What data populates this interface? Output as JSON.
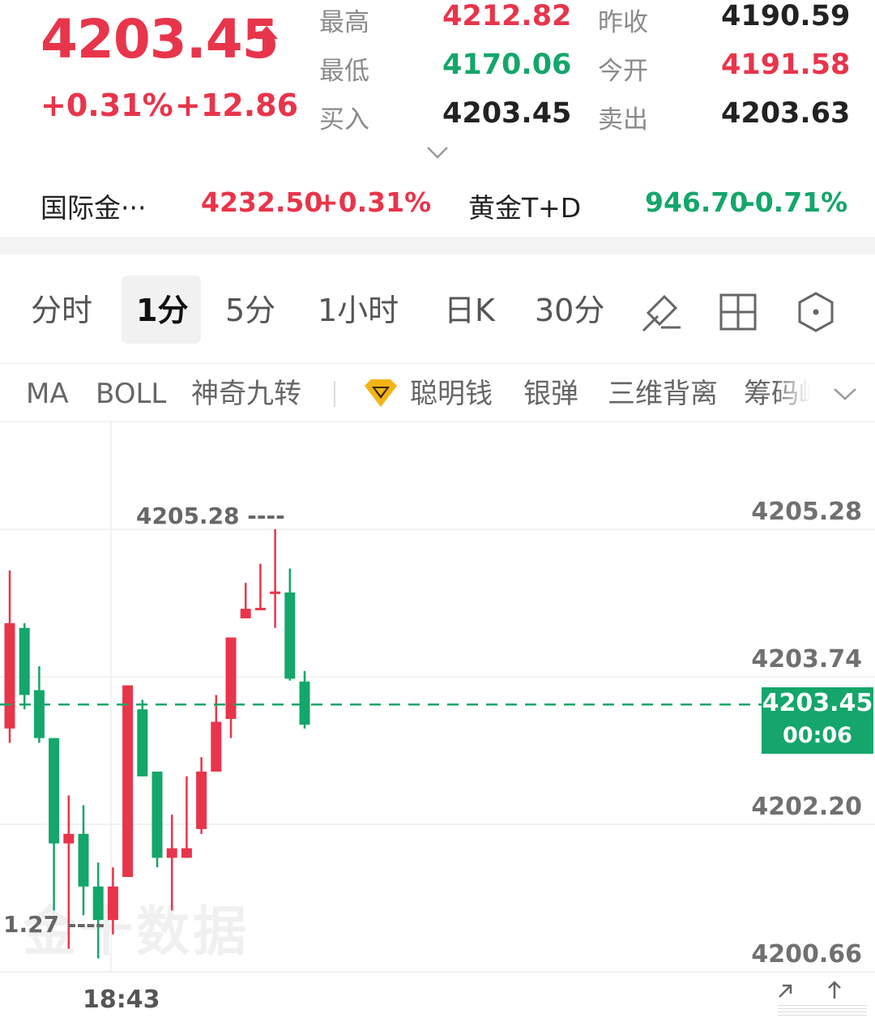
{
  "quote": {
    "price": "4203.45",
    "change_pct": "+0.31%",
    "change_abs": "+12.86",
    "fields": [
      {
        "label": "最高",
        "value": "4212.82",
        "color": "#e8354b"
      },
      {
        "label": "昨收",
        "value": "4190.59",
        "color": "#222222"
      },
      {
        "label": "最低",
        "value": "4170.06",
        "color": "#14a66a"
      },
      {
        "label": "今开",
        "value": "4191.58",
        "color": "#e8354b"
      },
      {
        "label": "买入",
        "value": "4203.45",
        "color": "#222222"
      },
      {
        "label": "卖出",
        "value": "4203.63",
        "color": "#222222"
      }
    ]
  },
  "related": [
    {
      "name": "国际金···",
      "value": "4232.50",
      "pct": "+0.31%",
      "color": "#e8354b"
    },
    {
      "name": "黄金T+D",
      "value": "946.70",
      "pct": "-0.71%",
      "color": "#14a66a"
    }
  ],
  "period_tabs": [
    "分时",
    "1分",
    "5分",
    "1小时",
    "日K",
    "30分"
  ],
  "active_tab": "1分",
  "tool_icons": [
    "draw-tool-icon",
    "grid-layout-icon",
    "hexagon-settings-icon"
  ],
  "indicators": [
    "MA",
    "BOLL",
    "神奇九转",
    "聪明钱",
    "银弹",
    "三维背离",
    "筹码峰"
  ],
  "chart": {
    "y_ticks": [
      "4205.28",
      "4203.74",
      "4202.20",
      "4200.66"
    ],
    "last_price": "4203.45",
    "countdown": "00:06",
    "time_label": "18:43",
    "high_annotation": "4205.28",
    "low_annotation": "1.27",
    "watermark": "金十数据",
    "colors": {
      "up": "#e8354b",
      "down": "#14a66a"
    }
  },
  "chart_data": {
    "type": "candlestick",
    "ylim": [
      4200.66,
      4205.28
    ],
    "y_ticks": [
      4205.28,
      4203.74,
      4202.2,
      4200.66
    ],
    "x_tick_labels": [
      "18:43"
    ],
    "candles": [
      {
        "open": 4203.2,
        "close": 4204.3,
        "high": 4204.85,
        "low": 4203.05
      },
      {
        "open": 4204.25,
        "close": 4203.55,
        "high": 4204.3,
        "low": 4203.4
      },
      {
        "open": 4203.6,
        "close": 4203.1,
        "high": 4203.85,
        "low": 4203.05
      },
      {
        "open": 4203.1,
        "close": 4202.0,
        "high": 4203.1,
        "low": 4201.3
      },
      {
        "open": 4202.0,
        "close": 4202.1,
        "high": 4202.5,
        "low": 4200.9
      },
      {
        "open": 4202.1,
        "close": 4201.55,
        "high": 4202.4,
        "low": 4201.25
      },
      {
        "open": 4201.55,
        "close": 4201.2,
        "high": 4201.8,
        "low": 4200.8
      },
      {
        "open": 4201.2,
        "close": 4201.55,
        "high": 4201.75,
        "low": 4201.05
      },
      {
        "open": 4201.65,
        "close": 4203.65,
        "high": 4203.65,
        "low": 4201.65
      },
      {
        "open": 4203.4,
        "close": 4202.7,
        "high": 4203.5,
        "low": 4202.7
      },
      {
        "open": 4202.75,
        "close": 4201.85,
        "high": 4202.75,
        "low": 4201.75
      },
      {
        "open": 4201.85,
        "close": 4201.95,
        "high": 4202.3,
        "low": 4201.3
      },
      {
        "open": 4201.85,
        "close": 4201.95,
        "high": 4202.7,
        "low": 4201.85
      },
      {
        "open": 4202.15,
        "close": 4202.75,
        "high": 4202.9,
        "low": 4202.1
      },
      {
        "open": 4202.75,
        "close": 4203.27,
        "high": 4203.55,
        "low": 4202.75
      },
      {
        "open": 4203.3,
        "close": 4204.15,
        "high": 4204.15,
        "low": 4203.1
      },
      {
        "open": 4204.35,
        "close": 4204.45,
        "high": 4204.72,
        "low": 4204.35
      },
      {
        "open": 4204.45,
        "close": 4204.46,
        "high": 4204.92,
        "low": 4204.45
      },
      {
        "open": 4204.62,
        "close": 4204.63,
        "high": 4205.28,
        "low": 4204.25
      },
      {
        "open": 4204.62,
        "close": 4203.72,
        "high": 4204.87,
        "low": 4203.7
      },
      {
        "open": 4203.69,
        "close": 4203.24,
        "high": 4203.8,
        "low": 4203.2
      }
    ]
  }
}
